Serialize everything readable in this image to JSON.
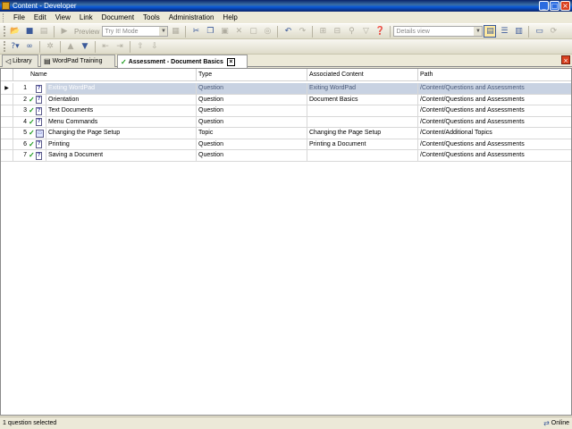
{
  "window": {
    "title": "Content - Developer"
  },
  "menu": [
    "File",
    "Edit",
    "View",
    "Link",
    "Document",
    "Tools",
    "Administration",
    "Help"
  ],
  "toolbar": {
    "preview_label": "Preview",
    "mode_value": "Try It! Mode",
    "view_value": "Details view"
  },
  "tabs": [
    {
      "label": "Library",
      "icon": "library-icon",
      "active": false
    },
    {
      "label": "WordPad Training",
      "icon": "outline-icon",
      "active": false
    },
    {
      "label": "Assessment - Document Basics",
      "icon": "assessment-icon",
      "active": true
    }
  ],
  "grid": {
    "columns": [
      "Name",
      "Type",
      "Associated Content",
      "Path"
    ],
    "rows": [
      {
        "num": "1",
        "checked": false,
        "icon": "question-icon",
        "name": "Exiting WordPad",
        "type": "Question",
        "content": "Exiting WordPad",
        "path": "/Content/Questions and Assessments",
        "selected": true
      },
      {
        "num": "2",
        "checked": true,
        "icon": "question-icon",
        "name": "Orientation",
        "type": "Question",
        "content": "Document Basics",
        "path": "/Content/Questions and Assessments",
        "selected": false
      },
      {
        "num": "3",
        "checked": true,
        "icon": "question-icon",
        "name": "Text Documents",
        "type": "Question",
        "content": "",
        "path": "/Content/Questions and Assessments",
        "selected": false
      },
      {
        "num": "4",
        "checked": true,
        "icon": "question-icon",
        "name": "Menu Commands",
        "type": "Question",
        "content": "",
        "path": "/Content/Questions and Assessments",
        "selected": false
      },
      {
        "num": "5",
        "checked": true,
        "icon": "topic-icon",
        "name": "Changing the Page Setup",
        "type": "Topic",
        "content": "Changing the Page Setup",
        "path": "/Content/Additional Topics",
        "selected": false
      },
      {
        "num": "6",
        "checked": true,
        "icon": "question-icon",
        "name": "Printing",
        "type": "Question",
        "content": "Printing a Document",
        "path": "/Content/Questions and Assessments",
        "selected": false
      },
      {
        "num": "7",
        "checked": true,
        "icon": "question-icon",
        "name": "Saving a Document",
        "type": "Question",
        "content": "",
        "path": "/Content/Questions and Assessments",
        "selected": false
      }
    ]
  },
  "status": {
    "left": "1 question selected",
    "right": "Online"
  }
}
